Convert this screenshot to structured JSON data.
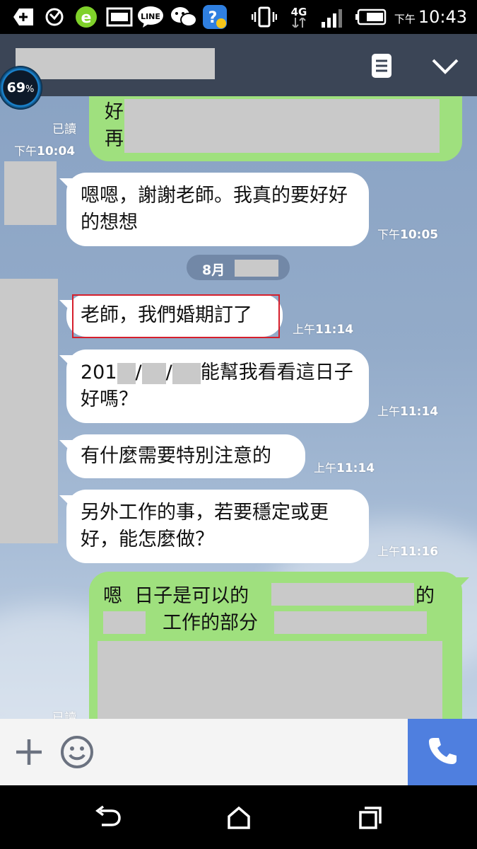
{
  "status_bar": {
    "ampm": "下午",
    "time": "10:43",
    "network": "4G",
    "icons": [
      "add-icon",
      "sync-icon",
      "ie-browser-icon",
      "gallery-icon",
      "line-app-icon",
      "wechat-icon",
      "help-app-icon",
      "vibrate-icon",
      "network-4g-icon",
      "signal-icon",
      "battery-icon"
    ]
  },
  "battery_overlay": {
    "percent": "69",
    "unit": "%"
  },
  "header": {
    "icons": [
      "menu-notes-icon",
      "chevron-down-icon"
    ]
  },
  "messages": [
    {
      "side": "out",
      "line1_prefix": "好",
      "line2_prefix": "再",
      "read": "已讀",
      "ampm": "下午",
      "time": "10:04"
    },
    {
      "side": "in",
      "text": "嗯嗯，謝謝老師。我真的要好好的想想",
      "ampm": "下午",
      "time": "10:05"
    },
    {
      "side": "in",
      "text": "老師，我們婚期訂了",
      "ampm": "上午",
      "time": "11:14",
      "highlighted": true
    },
    {
      "side": "in",
      "prefix": "201",
      "sep1": "/",
      "sep2": "/",
      "suffix": "能幫我看看這日子好嗎？",
      "ampm": "上午",
      "time": "11:14"
    },
    {
      "side": "in",
      "text": "有什麼需要特別注意的",
      "ampm": "上午",
      "time": "11:14"
    },
    {
      "side": "in",
      "text": "另外工作的事，若要穩定或更好，能怎麼做？",
      "ampm": "上午",
      "time": "11:16"
    },
    {
      "side": "out",
      "line1_prefix": "嗯  日子是可以的",
      "line1_suffix": "的",
      "line2_text": "工作的部分",
      "read": "已讀"
    }
  ],
  "date_separator": {
    "label": "8月"
  },
  "input_bar": {
    "icons": [
      "plus-icon",
      "emoji-icon",
      "phone-icon"
    ]
  },
  "nav_bar": {
    "icons": [
      "back-icon",
      "home-icon",
      "recent-apps-icon"
    ]
  },
  "colors": {
    "header": "#3b4556",
    "bubble_out": "#9fe07e",
    "bubble_in": "#ffffff",
    "call_button": "#4f7fdf",
    "highlight": "#d61f2c"
  }
}
